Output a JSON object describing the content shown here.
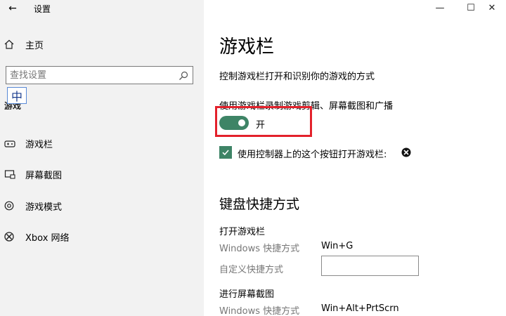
{
  "window": {
    "title": "设置",
    "back_glyph": "←",
    "minimize_glyph": "—",
    "maximize_glyph": "☐",
    "close_glyph": "✕"
  },
  "sidebar": {
    "home_label": "主页",
    "search_placeholder": "查找设置",
    "ime_indicator": "中",
    "section_label": "游戏",
    "items": [
      {
        "label": "游戏栏",
        "icon": "game-bar-icon"
      },
      {
        "label": "屏幕截图",
        "icon": "captures-icon"
      },
      {
        "label": "游戏模式",
        "icon": "game-mode-icon"
      },
      {
        "label": "Xbox 网络",
        "icon": "xbox-icon"
      }
    ]
  },
  "main": {
    "title": "游戏栏",
    "description": "控制游戏栏打开和识别你的游戏的方式",
    "toggle": {
      "label": "使用游戏栏录制游戏剪辑、屏幕截图和广播",
      "state": "开",
      "on": true
    },
    "checkbox": {
      "label": "使用控制器上的这个按钮打开游戏栏:",
      "checked": true
    },
    "keyboard": {
      "title": "键盘快捷方式",
      "groups": [
        {
          "title": "打开游戏栏",
          "windows_label": "Windows 快捷方式",
          "windows_value": "Win+G",
          "custom_label": "自定义快捷方式",
          "custom_value": ""
        },
        {
          "title": "进行屏幕截图",
          "windows_label": "Windows 快捷方式",
          "windows_value": "Win+Alt+PrtScrn"
        }
      ]
    }
  },
  "colors": {
    "accent": "#3e8466",
    "highlight": "#e3212b",
    "sidebar_bg": "#f2f2f2"
  }
}
